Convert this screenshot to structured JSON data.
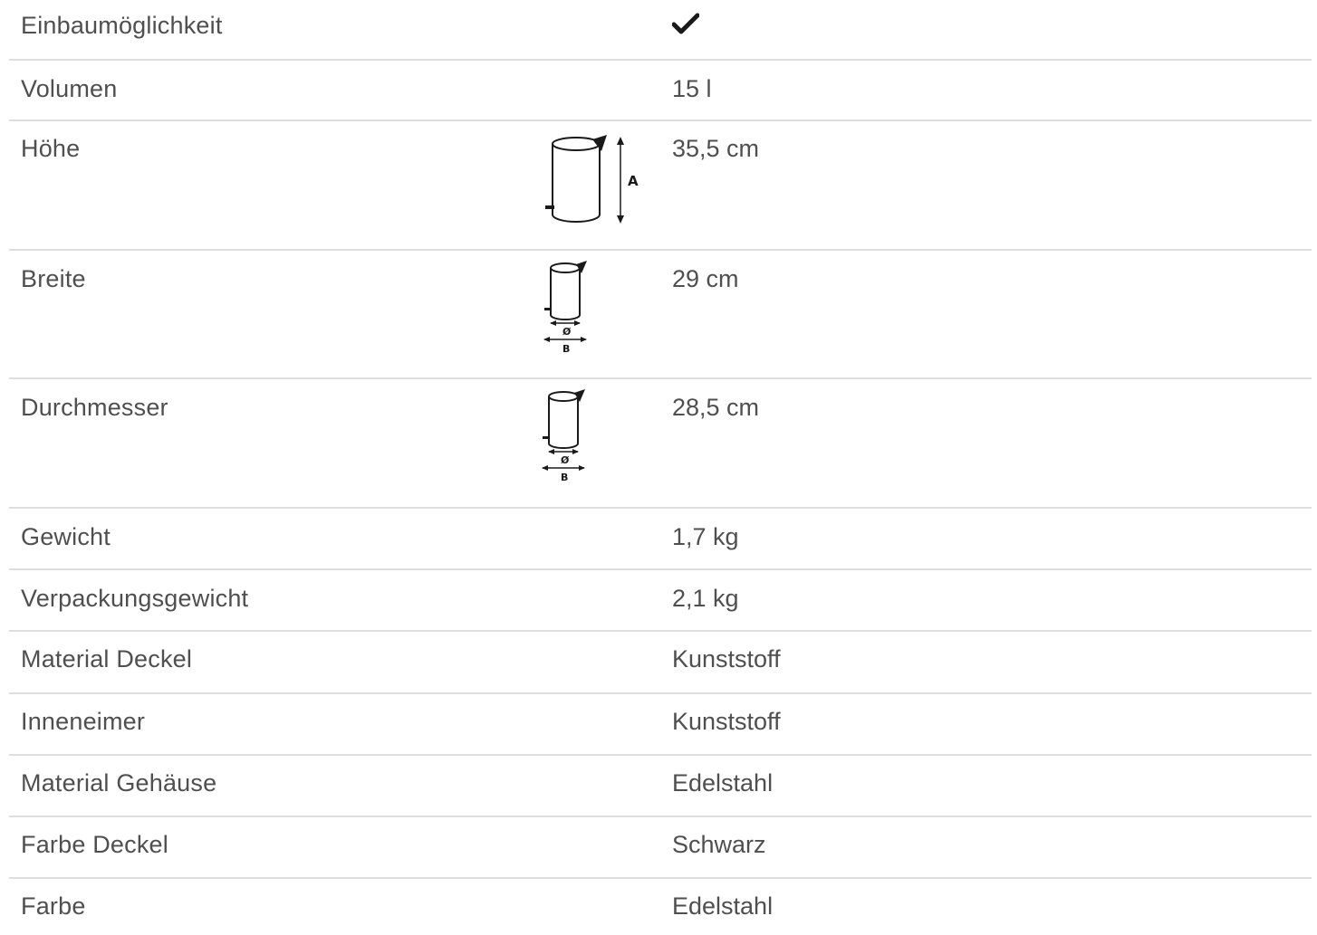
{
  "rows": [
    {
      "label": "Einbaumöglichkeit",
      "value": "",
      "value_icon": "checkmark-icon"
    },
    {
      "label": "Volumen",
      "value": "15 l"
    },
    {
      "label": "Höhe",
      "value": "35,5 cm",
      "diagram": "height-diagram-icon",
      "diagram_text": "A"
    },
    {
      "label": "Breite",
      "value": "29 cm",
      "diagram": "width-diagram-icon",
      "diagram_text_1": "Ø",
      "diagram_text_2": "B"
    },
    {
      "label": "Durchmesser",
      "value": "28,5 cm",
      "diagram": "diameter-diagram-icon",
      "diagram_text_1": "Ø",
      "diagram_text_2": "B"
    },
    {
      "label": "Gewicht",
      "value": "1,7 kg"
    },
    {
      "label": "Verpackungsgewicht",
      "value": "2,1 kg"
    },
    {
      "label": "Material Deckel",
      "value": "Kunststoff"
    },
    {
      "label": "Inneneimer",
      "value": "Kunststoff"
    },
    {
      "label": "Material Gehäuse",
      "value": "Edelstahl"
    },
    {
      "label": "Farbe Deckel",
      "value": "Schwarz"
    },
    {
      "label": "Farbe",
      "value": "Edelstahl"
    }
  ],
  "colors": {
    "text": "#4f4f4f",
    "divider": "#dedede",
    "icon": "#1a1a1a"
  }
}
